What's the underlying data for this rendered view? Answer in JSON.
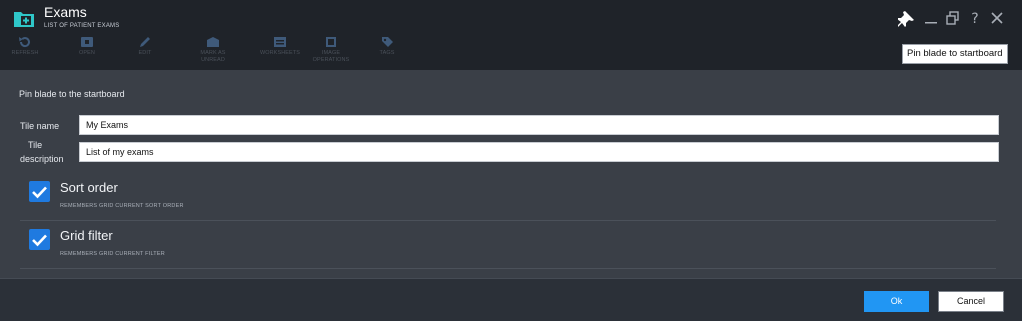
{
  "header": {
    "title": "Exams",
    "subtitle": "LIST OF PATIENT EXAMS",
    "toolbar": [
      {
        "label": "REFRESH",
        "icon": "refresh-icon"
      },
      {
        "label": "OPEN",
        "icon": "open-icon"
      },
      {
        "label": "EDIT",
        "icon": "edit-icon"
      },
      {
        "label": "MARK AS UNREAD",
        "icon": "mark-unread-icon"
      },
      {
        "label": "WORKSHEETS",
        "icon": "worksheets-icon"
      },
      {
        "label": "IMAGE OPERATIONS",
        "icon": "image-operations-icon"
      },
      {
        "label": "TAGS",
        "icon": "tags-icon"
      }
    ],
    "window_controls": [
      "pin-icon",
      "minimize-icon",
      "restore-icon",
      "help-icon",
      "close-icon"
    ]
  },
  "tooltip": {
    "text": "Pin blade to startboard"
  },
  "panel": {
    "title": "Pin blade to the startboard",
    "tile_name_label": "Tile name",
    "tile_name_value": "My Exams",
    "tile_desc_label_1": "Tile",
    "tile_desc_label_2": "description",
    "tile_desc_value": "List of my exams",
    "options": [
      {
        "title": "Sort order",
        "desc": "REMEMBERS GRID CURRENT SORT ORDER",
        "checked": true
      },
      {
        "title": "Grid filter",
        "desc": "REMEMBERS GRID CURRENT FILTER",
        "checked": true
      }
    ]
  },
  "footer": {
    "ok_label": "Ok",
    "cancel_label": "Cancel"
  },
  "colors": {
    "accent": "#2196f3",
    "checkbox": "#1f7ae0",
    "header_bg": "#1f2329",
    "panel_bg": "#3a3f47"
  }
}
